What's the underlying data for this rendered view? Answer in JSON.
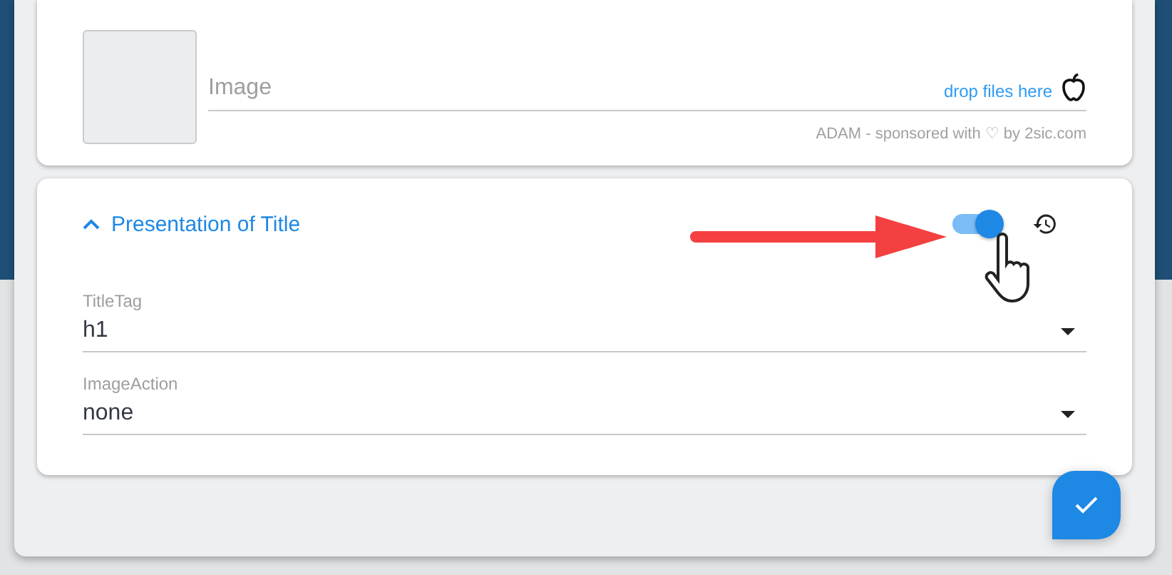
{
  "image_field": {
    "label": "Image",
    "drop_hint": "drop files here",
    "footer": "ADAM - sponsored with ♡ by 2sic.com"
  },
  "section": {
    "title": "Presentation of Title",
    "expanded": true,
    "toggle_on": true,
    "fields": [
      {
        "label": "TitleTag",
        "value": "h1"
      },
      {
        "label": "ImageAction",
        "value": "none"
      }
    ]
  }
}
